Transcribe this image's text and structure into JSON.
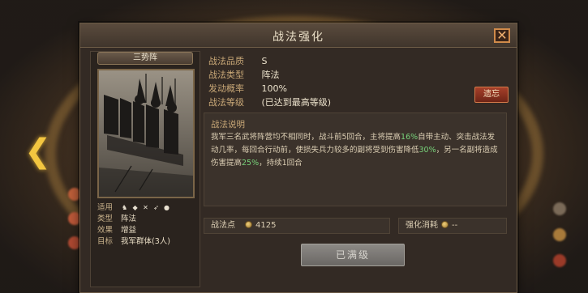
{
  "dialog": {
    "title": "战法强化",
    "close_label": "✕"
  },
  "card": {
    "name": "三势阵",
    "info": [
      {
        "key": "适用",
        "value": ""
      },
      {
        "key": "类型",
        "value": "阵法"
      },
      {
        "key": "效果",
        "value": "增益"
      },
      {
        "key": "目标",
        "value": "我军群体(3人)"
      }
    ],
    "arm_icons": [
      "cavalry-icon",
      "shield-icon",
      "crossed-spears-icon",
      "bow-icon",
      "siege-icon"
    ]
  },
  "meta": {
    "rows": [
      {
        "key": "战法品质",
        "value": "S"
      },
      {
        "key": "战法类型",
        "value": "阵法"
      },
      {
        "key": "发动概率",
        "value": "100%"
      },
      {
        "key": "战法等级",
        "value": "(已达到最高等级)"
      }
    ],
    "inherit_label": "遗忘"
  },
  "description": {
    "title": "战法说明",
    "segments": [
      {
        "text": "我军三名武将阵营均不相同时，战斗前5回合，主将提高",
        "highlight": false
      },
      {
        "text": "16%",
        "highlight": true
      },
      {
        "text": "自带主动、突击战法发动几率，每回合行动前，使损失兵力较多的副将受到伤害降低",
        "highlight": false
      },
      {
        "text": "30%",
        "highlight": true
      },
      {
        "text": "，另一名副将造成伤害提高",
        "highlight": false
      },
      {
        "text": "25%",
        "highlight": true
      },
      {
        "text": "，持续1回合",
        "highlight": false
      }
    ]
  },
  "stats": {
    "points_label": "战法点",
    "points_value": "4125",
    "cost_label": "强化消耗",
    "cost_value": "--"
  },
  "actions": {
    "maxed_label": "已满级"
  },
  "colors": {
    "highlight": "#78d27a",
    "accent_gold": "#f3c640",
    "button_red": "#a6402a"
  }
}
